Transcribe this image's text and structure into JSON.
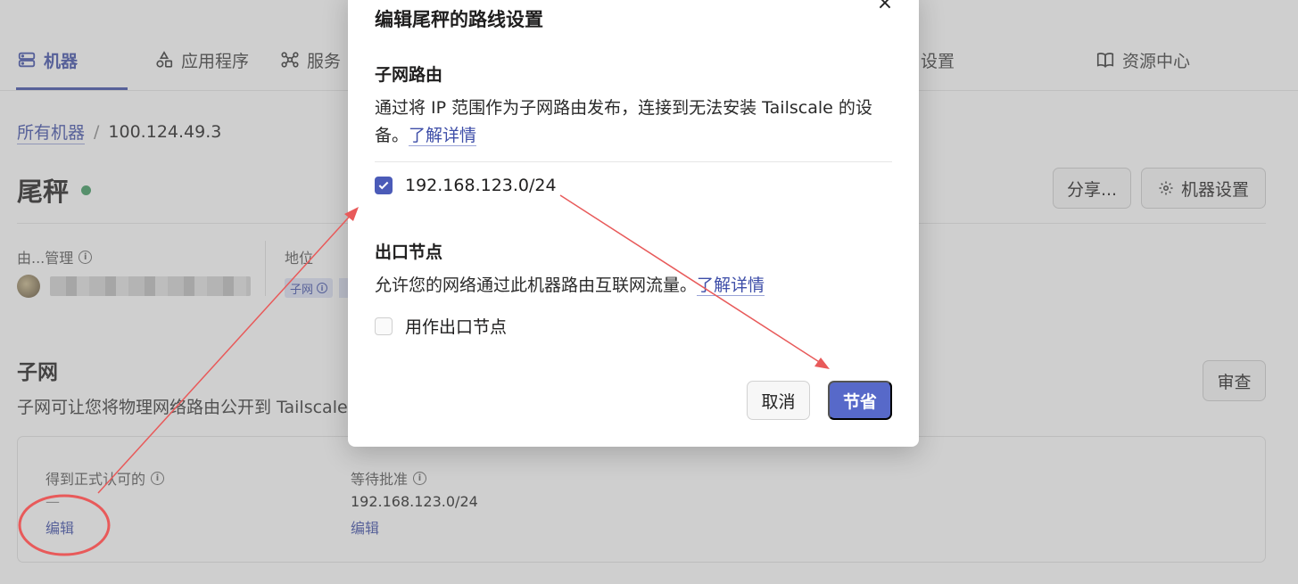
{
  "nav": {
    "items": [
      {
        "label": "机器",
        "icon": "machines-icon",
        "active": true
      },
      {
        "label": "应用程序",
        "icon": "apps-icon"
      },
      {
        "label": "服务",
        "icon": "services-icon"
      },
      {
        "label": "设置",
        "icon": ""
      },
      {
        "label": "资源中心",
        "icon": "book-icon"
      }
    ]
  },
  "breadcrumb": {
    "parent": "所有机器",
    "separator": "/",
    "current": "100.124.49.3"
  },
  "machine": {
    "name": "尾秤",
    "status_color": "#3e9a60"
  },
  "header_buttons": {
    "share": "分享...",
    "settings": "机器设置"
  },
  "meta": {
    "managed_by_label": "由...管理",
    "status_label": "地位",
    "tag_label": "子网"
  },
  "subnet_section": {
    "title": "子网",
    "description": "子网可让您将物理网络路由公开到 Tailscale",
    "review_button": "审查",
    "approved_label": "得到正式认可的",
    "approved_value": "—",
    "approved_edit": "编辑",
    "pending_label": "等待批准",
    "pending_value": "192.168.123.0/24",
    "pending_edit": "编辑"
  },
  "modal": {
    "title": "编辑尾秤的路线设置",
    "close": "×",
    "subnet_heading": "子网路由",
    "subnet_desc": "通过将 IP 范围作为子网路由发布，连接到无法安装 Tailscale 的设备。",
    "subnet_learn": "了解详情",
    "route": "192.168.123.0/24",
    "exit_heading": "出口节点",
    "exit_desc": "允许您的网络通过此机器路由互联网流量。",
    "exit_learn": "了解详情",
    "exit_option": "用作出口节点",
    "cancel": "取消",
    "save": "节省"
  },
  "colors": {
    "accent": "#3e4ea8",
    "primary_button": "#5769c9",
    "annotation": "#e85a5a"
  }
}
